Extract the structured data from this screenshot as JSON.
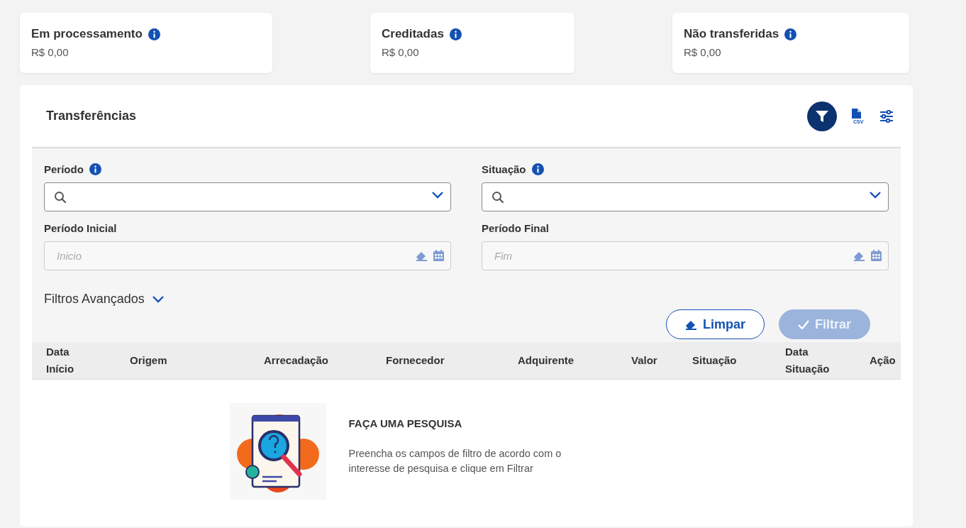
{
  "summary_cards": [
    {
      "title": "Em processamento",
      "amount": "R$ 0,00"
    },
    {
      "title": "Creditadas",
      "amount": "R$ 0,00"
    },
    {
      "title": "Não transferidas",
      "amount": "R$ 0,00"
    }
  ],
  "panel": {
    "title": "Transferências",
    "toolbar": [
      {
        "kind": "filter",
        "selected": true
      },
      {
        "kind": "csv",
        "selected": false,
        "label": "CSV"
      },
      {
        "kind": "settings",
        "selected": false
      }
    ]
  },
  "filters": [
    {
      "kind": "select",
      "label": "Período",
      "info": true
    },
    {
      "kind": "select",
      "label": "Situação",
      "info": true
    },
    {
      "kind": "date",
      "label": "Período Inicial",
      "info": false,
      "placeholder": "Inicio"
    },
    {
      "kind": "date",
      "label": "Período Final",
      "info": false,
      "placeholder": "Fim"
    }
  ],
  "advanced_filters": {
    "label": "Filtros Avançados",
    "expanded": false
  },
  "buttons": [
    {
      "kind": "clear",
      "label": "Limpar",
      "disabled": false
    },
    {
      "kind": "apply",
      "label": "Filtrar",
      "disabled": true
    }
  ],
  "table": {
    "columns": [
      "Data Início",
      "Origem",
      "Arrecadação",
      "Fornecedor",
      "Adquirente",
      "Valor",
      "Situação",
      "Data Situação",
      "Ação"
    ]
  },
  "empty_state": {
    "title": "FAÇA UMA PESQUISA",
    "message": "Preencha os campos de filtro de acordo com o interesse de pesquisa e clique em Filtrar"
  }
}
